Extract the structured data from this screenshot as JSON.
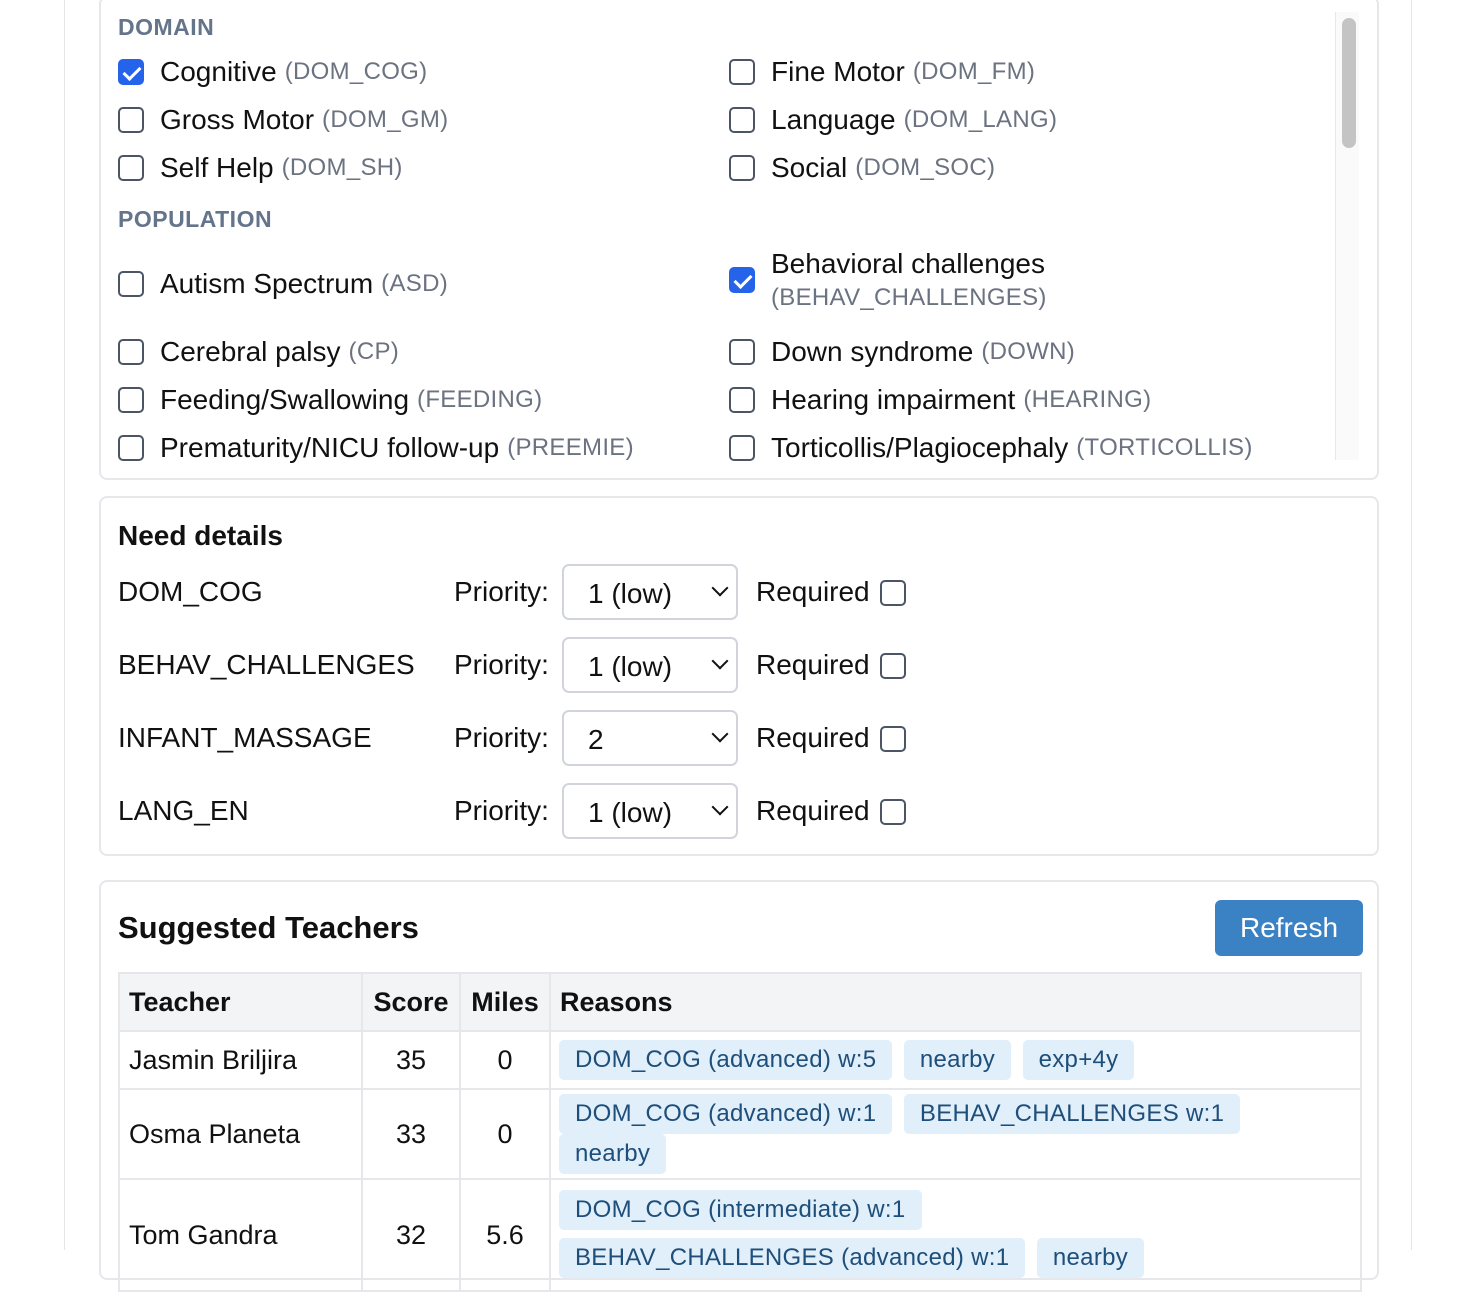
{
  "picker": {
    "domain_heading": "DOMAIN",
    "domain": [
      {
        "label": "Cognitive",
        "code": "(DOM_COG)",
        "checked": true
      },
      {
        "label": "Fine Motor",
        "code": "(DOM_FM)",
        "checked": false
      },
      {
        "label": "Gross Motor",
        "code": "(DOM_GM)",
        "checked": false
      },
      {
        "label": "Language",
        "code": "(DOM_LANG)",
        "checked": false
      },
      {
        "label": "Self Help",
        "code": "(DOM_SH)",
        "checked": false
      },
      {
        "label": "Social",
        "code": "(DOM_SOC)",
        "checked": false
      }
    ],
    "population_heading": "POPULATION",
    "population": [
      {
        "label": "Autism Spectrum",
        "code": "(ASD)",
        "checked": false
      },
      {
        "label": "Behavioral challenges",
        "code": "(BEHAV_CHALLENGES)",
        "checked": true
      },
      {
        "label": "Cerebral palsy",
        "code": "(CP)",
        "checked": false
      },
      {
        "label": "Down syndrome",
        "code": "(DOWN)",
        "checked": false
      },
      {
        "label": "Feeding/Swallowing",
        "code": "(FEEDING)",
        "checked": false
      },
      {
        "label": "Hearing impairment",
        "code": "(HEARING)",
        "checked": false
      },
      {
        "label": "Prematurity/NICU follow-up",
        "code": "(PREEMIE)",
        "checked": false
      },
      {
        "label": "Torticollis/Plagiocephaly",
        "code": "(TORTICOLLIS)",
        "checked": false
      }
    ]
  },
  "need_details": {
    "title": "Need details",
    "priority_label": "Priority:",
    "required_label": "Required",
    "rows": [
      {
        "tag": "DOM_COG",
        "priority": "1 (low)",
        "required": false
      },
      {
        "tag": "BEHAV_CHALLENGES",
        "priority": "1 (low)",
        "required": false
      },
      {
        "tag": "INFANT_MASSAGE",
        "priority": "2",
        "required": false
      },
      {
        "tag": "LANG_EN",
        "priority": "1 (low)",
        "required": false
      }
    ]
  },
  "suggested": {
    "title": "Suggested Teachers",
    "refresh_label": "Refresh",
    "columns": [
      "Teacher",
      "Score",
      "Miles",
      "Reasons"
    ],
    "rows": [
      {
        "teacher": "Jasmin Briljira",
        "score": "35",
        "miles": "0",
        "reasons": [
          "DOM_COG (advanced) w:5",
          "nearby",
          "exp+4y"
        ]
      },
      {
        "teacher": "Osma Planeta",
        "score": "33",
        "miles": "0",
        "reasons": [
          "DOM_COG (advanced) w:1",
          "BEHAV_CHALLENGES w:1",
          "nearby"
        ]
      },
      {
        "teacher": "Tom Gandra",
        "score": "32",
        "miles": "5.6",
        "reasons": [
          "DOM_COG (intermediate) w:1",
          "BEHAV_CHALLENGES (advanced) w:1",
          "nearby"
        ]
      }
    ]
  },
  "colors": {
    "accent": "#2563eb",
    "button": "#3b82c4",
    "chip_bg": "#e0effa",
    "chip_text": "#1e4e7a",
    "muted": "#6b7280"
  }
}
